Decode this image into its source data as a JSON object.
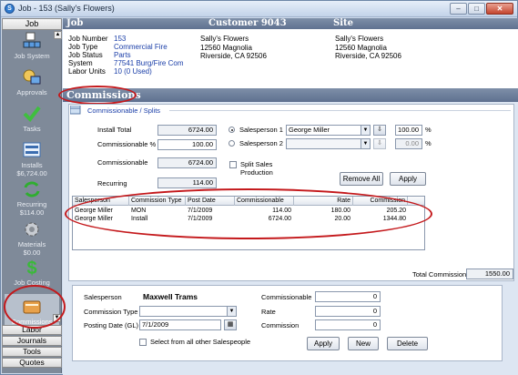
{
  "window": {
    "title": "Job - 153 (Sally's Flowers)",
    "minimize": "–",
    "maximize": "□",
    "close": "✕"
  },
  "nav": {
    "header": "Job",
    "items": [
      {
        "label": "Job System",
        "icon": "job-system-icon"
      },
      {
        "label": "Approvals",
        "icon": "approvals-icon"
      },
      {
        "label": "Tasks",
        "icon": "tasks-icon"
      },
      {
        "label": "Installs",
        "sub": "$6,724.00",
        "icon": "installs-icon"
      },
      {
        "label": "Recurring",
        "sub": "$114.00",
        "icon": "recurring-icon"
      },
      {
        "label": "Materials",
        "sub": "$0.00",
        "icon": "materials-icon"
      },
      {
        "label": "Job Costing",
        "icon": "job-costing-icon"
      },
      {
        "label": "Commissions",
        "icon": "commissions-icon"
      }
    ],
    "tabs": [
      "Labor",
      "Journals",
      "Tools",
      "Quotes"
    ]
  },
  "header": {
    "col1": "Job",
    "col2": "Customer 9043",
    "col3": "Site"
  },
  "job": {
    "number_label": "Job Number",
    "number": "153",
    "type_label": "Job Type",
    "type": "Commercial Fire",
    "status_label": "Job Status",
    "status": "Parts",
    "system_label": "System",
    "system": "77541 Burg/Fire Com",
    "labor_label": "Labor Units",
    "labor": "10 (0 Used)"
  },
  "customer": {
    "line1": "Sally's Flowers",
    "line2": "12560 Magnolia",
    "line3": "Riverside, CA  92506"
  },
  "site": {
    "line1": "Sally's Flowers",
    "line2": "12560 Magnolia",
    "line3": "Riverside, CA  92506"
  },
  "commissions": {
    "title": "Commissions",
    "splits_label": "Commissionable / Splits",
    "install_total_label": "Install Total",
    "install_total": "6724.00",
    "commissionable_pct_label": "Commissionable %",
    "commissionable_pct": "100.00",
    "commissionable_label": "Commissionable",
    "commissionable": "6724.00",
    "recurring_label": "Recurring",
    "recurring": "114.00",
    "salesperson1_label": "Salesperson 1",
    "salesperson1": "George Miller",
    "salesperson1_pct": "100.00",
    "salesperson2_label": "Salesperson 2",
    "salesperson2": "",
    "salesperson2_pct": "0.00",
    "pct_sign": "%",
    "split_sales_label": "Split Sales Production",
    "remove_all": "Remove All",
    "apply": "Apply",
    "grid": {
      "headers": [
        "Salesperson",
        "Commission Type",
        "Post Date",
        "Commissionable",
        "Rate",
        "Commission"
      ],
      "rows": [
        [
          "George Miller",
          "MON",
          "7/1/2009",
          "114.00",
          "180.00",
          "205.20"
        ],
        [
          "George Miller",
          "Install",
          "7/1/2009",
          "6724.00",
          "20.00",
          "1344.80"
        ]
      ]
    },
    "total_label": "Total Commission",
    "total": "1550.00"
  },
  "editor": {
    "salesperson_label": "Salesperson",
    "salesperson": "Maxwell Trams",
    "commission_type_label": "Commission Type",
    "commission_type": "",
    "posting_date_label": "Posting Date (GL)",
    "posting_date": "7/1/2009",
    "select_all_label": "Select from all other Salespeople",
    "commissionable_label": "Commissionable",
    "commissionable": "0",
    "rate_label": "Rate",
    "rate": "0",
    "commission_label": "Commission",
    "commission": "0",
    "apply": "Apply",
    "new": "New",
    "delete": "Delete"
  },
  "colors": {
    "header_bar": "#6a7c99",
    "link_blue": "#1a3ea8",
    "highlight_red": "#c4191c"
  }
}
